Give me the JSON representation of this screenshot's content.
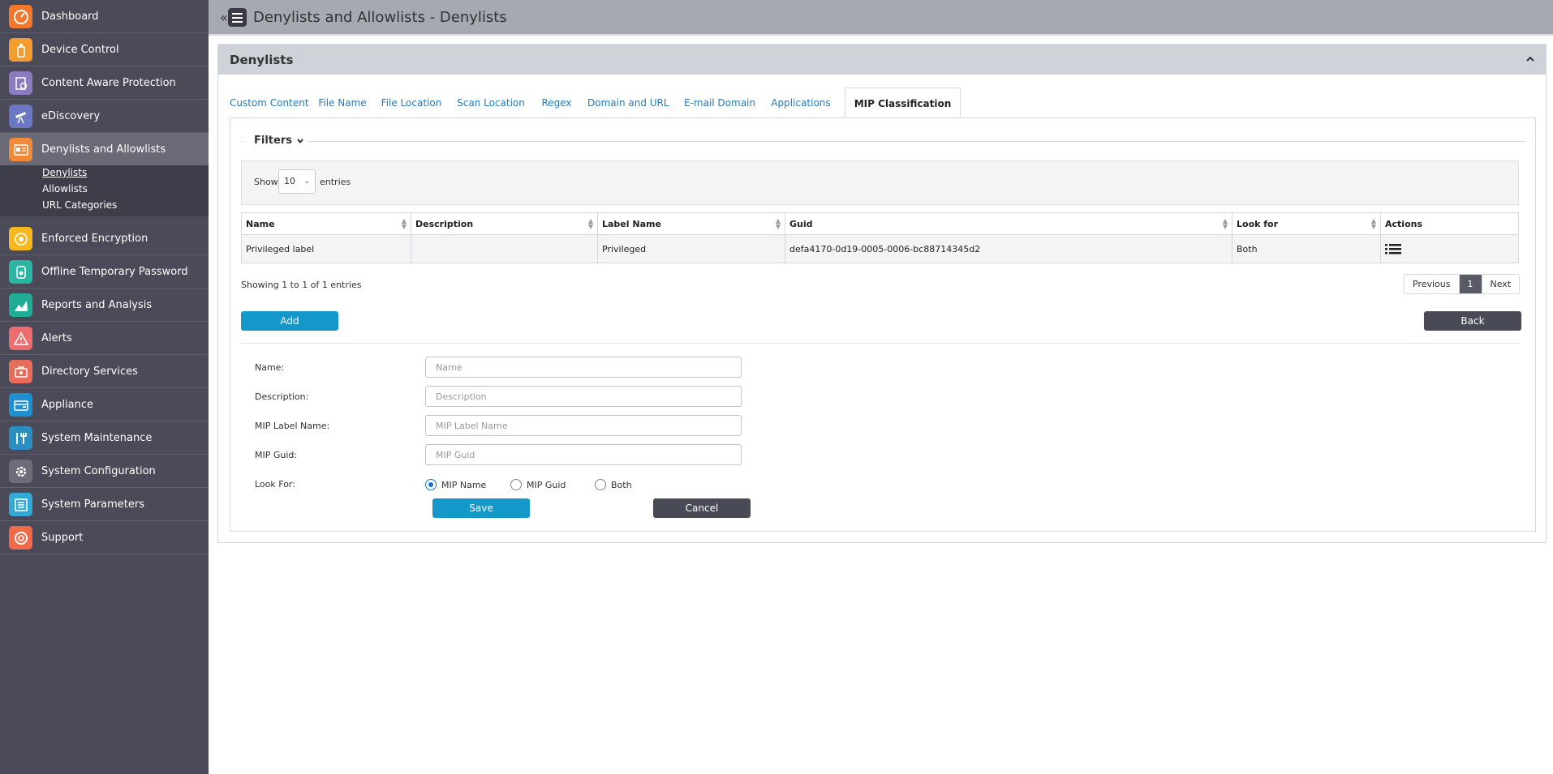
{
  "sidebar": {
    "items": [
      {
        "label": "Dashboard",
        "icon": "dashboard-icon",
        "color": "#f0772b"
      },
      {
        "label": "Device Control",
        "icon": "usb-icon",
        "color": "#f39d2e"
      },
      {
        "label": "Content Aware Protection",
        "icon": "content-protection-icon",
        "color": "#8a7cbf"
      },
      {
        "label": "eDiscovery",
        "icon": "telescope-icon",
        "color": "#6b79c4"
      },
      {
        "label": "Denylists and Allowlists",
        "icon": "list-card-icon",
        "color": "#f08a3a"
      },
      {
        "label": "Enforced Encryption",
        "icon": "encryption-icon",
        "color": "#f5b81f"
      },
      {
        "label": "Offline Temporary Password",
        "icon": "password-icon",
        "color": "#2bb5a5"
      },
      {
        "label": "Reports and Analysis",
        "icon": "chart-icon",
        "color": "#1fae95"
      },
      {
        "label": "Alerts",
        "icon": "alert-icon",
        "color": "#ec6d6d"
      },
      {
        "label": "Directory Services",
        "icon": "directory-icon",
        "color": "#e86c5a"
      },
      {
        "label": "Appliance",
        "icon": "appliance-icon",
        "color": "#1f8fd3"
      },
      {
        "label": "System Maintenance",
        "icon": "wrench-icon",
        "color": "#2a8fbf"
      },
      {
        "label": "System Configuration",
        "icon": "gear-icon",
        "color": "#6d6d7a"
      },
      {
        "label": "System Parameters",
        "icon": "parameters-icon",
        "color": "#33a9d6"
      },
      {
        "label": "Support",
        "icon": "lifebuoy-icon",
        "color": "#f06a4a"
      }
    ],
    "subitems": [
      "Denylists",
      "Allowlists",
      "URL Categories"
    ]
  },
  "header": {
    "collapse": "«",
    "title": "Denylists and Allowlists - Denylists"
  },
  "panel": {
    "title": "Denylists",
    "tabs": [
      "Custom Content",
      "File Name",
      "File Location",
      "Scan Location",
      "Regex",
      "Domain and URL",
      "E-mail Domain",
      "Applications",
      "MIP Classification"
    ],
    "active_tab": "MIP Classification"
  },
  "filters": {
    "label": "Filters",
    "show": "Show",
    "page_size": "10",
    "entries": "entries"
  },
  "table": {
    "columns": [
      "Name",
      "Description",
      "Label Name",
      "Guid",
      "Look for",
      "Actions"
    ],
    "rows": [
      {
        "name": "Privileged label",
        "description": "",
        "label_name": "Privileged",
        "guid": "defa4170-0d19-0005-0006-bc88714345d2",
        "look_for": "Both"
      }
    ],
    "info": "Showing 1 to 1 of 1 entries"
  },
  "pagination": {
    "previous": "Previous",
    "current": "1",
    "next": "Next"
  },
  "buttons": {
    "add": "Add",
    "back": "Back",
    "save": "Save",
    "cancel": "Cancel"
  },
  "form": {
    "name_label": "Name:",
    "name_placeholder": "Name",
    "description_label": "Description:",
    "description_placeholder": "Description",
    "mip_label_name_label": "MIP Label Name:",
    "mip_label_name_placeholder": "MIP Label Name",
    "mip_guid_label": "MIP Guid:",
    "mip_guid_placeholder": "MIP Guid",
    "look_for_label": "Look For:",
    "look_for_options": [
      "MIP Name",
      "MIP Guid",
      "Both"
    ],
    "look_for_selected": "MIP Name"
  }
}
